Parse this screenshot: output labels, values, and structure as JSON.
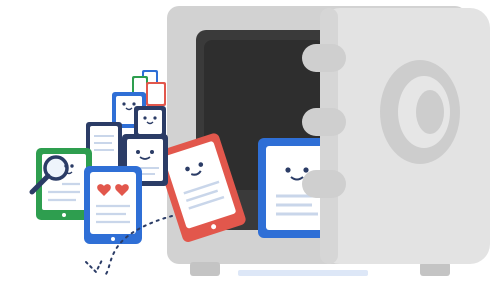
{
  "illustration": {
    "subject": "",
    "colors": {
      "safe_body": "#d2d2d2",
      "safe_body_shade": "#c4c4c4",
      "safe_interior": "#3a3a3a",
      "safe_door": "#e3e3e3",
      "safe_door_edge": "#d6d6d6",
      "hinge": "#cfcfcf",
      "dial_outer": "#cdcdcd",
      "dial_inner": "#e6e6e6",
      "blue": "#2f6fd6",
      "red": "#e2574c",
      "green": "#2e9e4f",
      "navy": "#2b3c66",
      "heart": "#e2574c",
      "page_white": "#ffffff",
      "line": "#c9d6ea",
      "face": "#2b3c66",
      "shelf": "#dde7f7"
    },
    "icons": [
      "safe-icon",
      "tablet-icon",
      "phone-icon",
      "document-icon",
      "magnifier-icon",
      "heart-icon",
      "dotted-trail-icon"
    ]
  }
}
